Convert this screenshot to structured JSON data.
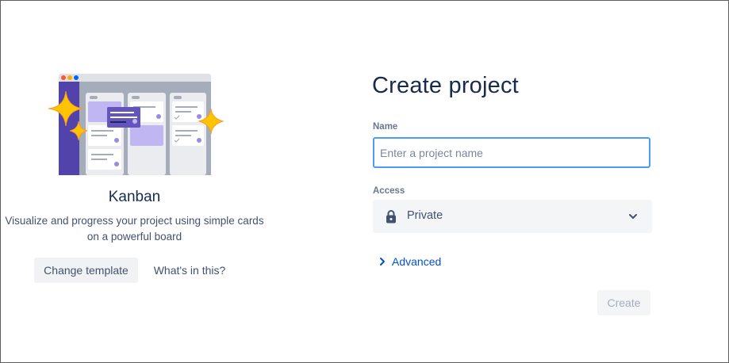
{
  "template": {
    "name": "Kanban",
    "description": "Visualize and progress your project using simple cards on a powerful board",
    "change_label": "Change template",
    "info_label": "What's in this?",
    "illustration_icon": "kanban-board-illustration"
  },
  "form": {
    "title": "Create project",
    "name": {
      "label": "Name",
      "value": "",
      "placeholder": "Enter a project name"
    },
    "access": {
      "label": "Access",
      "value": "Private",
      "icon": "lock-icon"
    },
    "advanced_label": "Advanced",
    "create_label": "Create"
  },
  "colors": {
    "link": "#0052cc",
    "focus": "#4c9aff",
    "text_dark": "#172b4d",
    "text_muted": "#42526e"
  }
}
